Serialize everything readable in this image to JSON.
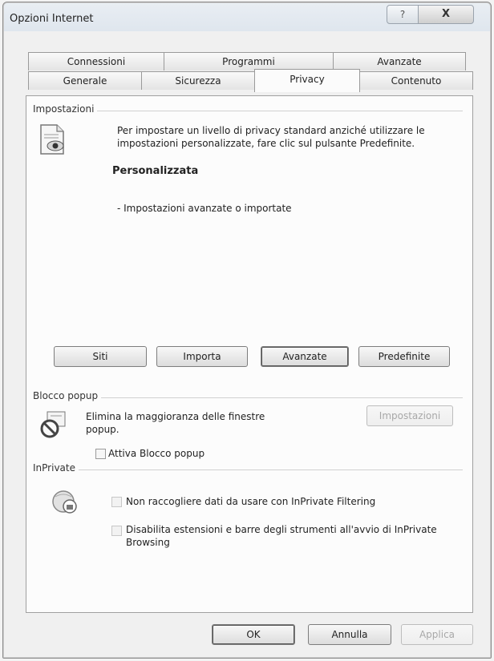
{
  "window": {
    "title": "Opzioni Internet",
    "help_glyph": "?",
    "close_glyph": "X"
  },
  "tabs": {
    "row1": [
      "Connessioni",
      "Programmi",
      "Avanzate"
    ],
    "row2": [
      "Generale",
      "Sicurezza",
      "Privacy",
      "Contenuto"
    ],
    "active": "Privacy"
  },
  "settings": {
    "group_label": "Impostazioni",
    "description": "Per impostare un livello di privacy standard anziché utilizzare le impostazioni personalizzate, fare clic sul pulsante Predefinite.",
    "level_title": "Personalizzata",
    "level_detail": "- Impostazioni avanzate o importate",
    "buttons": {
      "sites": "Siti",
      "import": "Importa",
      "advanced": "Avanzate",
      "default": "Predefinite"
    }
  },
  "popup": {
    "group_label": "Blocco popup",
    "description": "Elimina la maggioranza delle finestre popup.",
    "settings_button": "Impostazioni",
    "enable_label": "Attiva Blocco popup"
  },
  "inprivate": {
    "group_label": "InPrivate",
    "no_data_label": "Non raccogliere dati da usare con InPrivate Filtering",
    "disable_ext_label": "Disabilita estensioni e barre degli strumenti all'avvio di InPrivate Browsing"
  },
  "footer": {
    "ok": "OK",
    "cancel": "Annulla",
    "apply": "Applica"
  }
}
